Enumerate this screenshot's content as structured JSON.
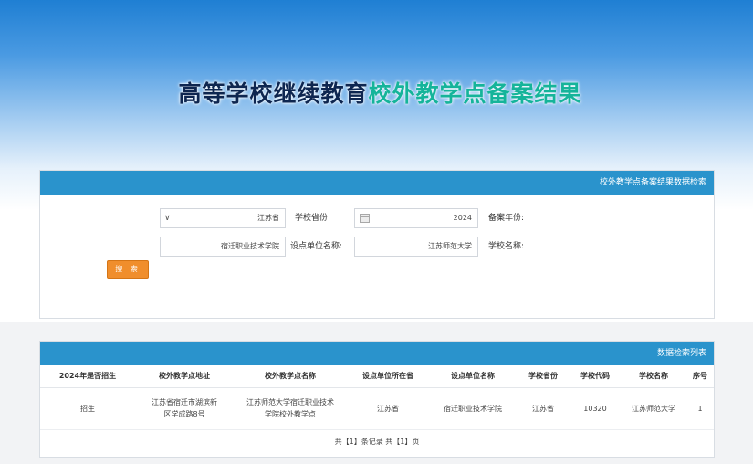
{
  "banner": {
    "title_part1": "高等学校继续教育",
    "title_part2": "校外教学点备案结果"
  },
  "search": {
    "header": "校外教学点备案结果数据检索",
    "year_label": "备案年份:",
    "year_value": "2024",
    "province_label": "学校省份:",
    "province_value": "江苏省",
    "school_label": "学校名称:",
    "school_value": "江苏师范大学",
    "unit_label": "设点单位名称:",
    "unit_value": "宿迁职业技术学院",
    "button": "搜 索"
  },
  "results": {
    "header": "数据检索列表",
    "columns": [
      "序号",
      "学校名称",
      "学校代码",
      "学校省份",
      "设点单位名称",
      "设点单位所在省",
      "校外教学点名称",
      "校外教学点地址",
      "2024年是否招生"
    ],
    "rows": [
      [
        "1",
        "江苏师范大学",
        "10320",
        "江苏省",
        "宿迁职业技术学院",
        "江苏省",
        "江苏师范大学宿迁职业技术学院校外教学点",
        "江苏省宿迁市湖滨新区学成路8号",
        "招生"
      ]
    ],
    "pager": "共【1】条记录 共【1】页"
  }
}
